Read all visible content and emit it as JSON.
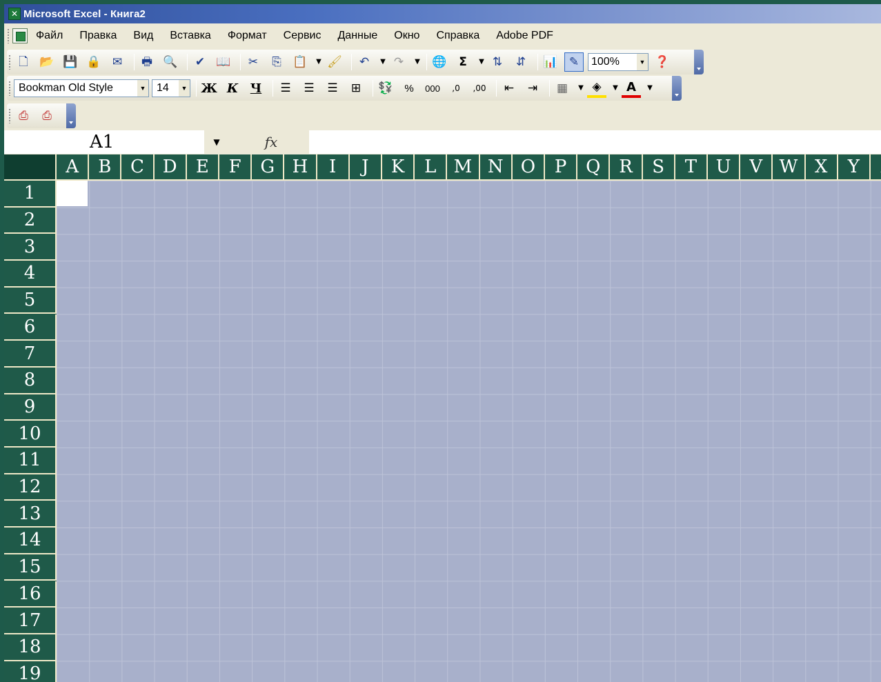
{
  "window": {
    "title": "Microsoft Excel - Книга2"
  },
  "menu": {
    "items": [
      "Файл",
      "Правка",
      "Вид",
      "Вставка",
      "Формат",
      "Сервис",
      "Данные",
      "Окно",
      "Справка",
      "Adobe PDF"
    ]
  },
  "toolbar": {
    "zoom": "100%",
    "font_name": "Bookman Old Style",
    "font_size": "14",
    "bold_label": "Ж",
    "italic_label": "К",
    "underline_label": "Ч",
    "percent_label": "%",
    "thousands_label": "000",
    "increase_decimal_label": ",0→,00",
    "decrease_decimal_label": ",00→,0",
    "sum_label": "Σ"
  },
  "formula_bar": {
    "name_box": "A1",
    "fx_label": "fx",
    "formula": ""
  },
  "sheet": {
    "columns": [
      "A",
      "B",
      "C",
      "D",
      "E",
      "F",
      "G",
      "H",
      "I",
      "J",
      "K",
      "L",
      "M",
      "N",
      "O",
      "P",
      "Q",
      "R",
      "S",
      "T",
      "U",
      "V",
      "W",
      "X",
      "Y",
      "Z"
    ],
    "rows": [
      "1",
      "2",
      "3",
      "4",
      "5",
      "6",
      "7",
      "8",
      "9",
      "10",
      "11",
      "12",
      "13",
      "14",
      "15",
      "16",
      "17",
      "18",
      "19"
    ]
  },
  "colors": {
    "grid_bg": "#a8b0cb",
    "header_bg": "#1f5a49",
    "header_text": "#ffffff",
    "titlebar": "#2f4f9a",
    "font_color_accent": "#e00000",
    "fill_color_accent": "#ffe000"
  }
}
